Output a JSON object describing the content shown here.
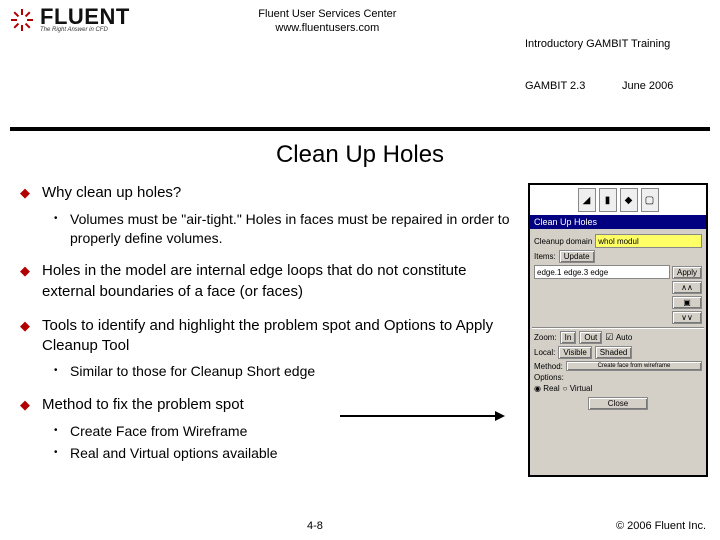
{
  "header": {
    "brand_name": "FLUENT",
    "brand_tag": "The Right Answer in CFD",
    "center_line1": "Fluent User Services Center",
    "center_line2": "www.fluentusers.com",
    "right_line1": "Introductory GAMBIT Training",
    "right_line2": "GAMBIT 2.3            June 2006"
  },
  "title": "Clean Up Holes",
  "bullets": {
    "b1": "Why clean up holes?",
    "b1s1": "Volumes must be \"air-tight.\"  Holes in faces must be repaired in order to properly define volumes.",
    "b2": "Holes in the model are internal edge loops that do not constitute external boundaries of a face (or faces)",
    "b3": "Tools to identify and highlight the problem spot and Options to Apply Cleanup Tool",
    "b3s1": "Similar to those for Cleanup Short edge",
    "b4": "Method to fix the problem spot",
    "b4s1": "Create Face from Wireframe",
    "b4s2": "Real and Virtual options available"
  },
  "panel": {
    "title": "Clean Up Holes",
    "domain_label": "Cleanup domain",
    "domain_val": "whol modul",
    "items_label": "Items:",
    "items_val": "Update",
    "edge_list": "edge.1 edge.3 edge",
    "apply": "Apply",
    "zoom_label": "Zoom:",
    "zoom_in": "In",
    "zoom_out": "Out",
    "auto": "Auto",
    "local_label": "Local:",
    "visible": "Visible",
    "shaded": "Shaded",
    "method_label": "Method:",
    "method_val": "Create face from wireframe",
    "options_label": "Options:",
    "opt_real": "Real",
    "opt_virtual": "Virtual",
    "close": "Close"
  },
  "footer": {
    "page": "4-8",
    "copyright": "© 2006 Fluent Inc."
  }
}
